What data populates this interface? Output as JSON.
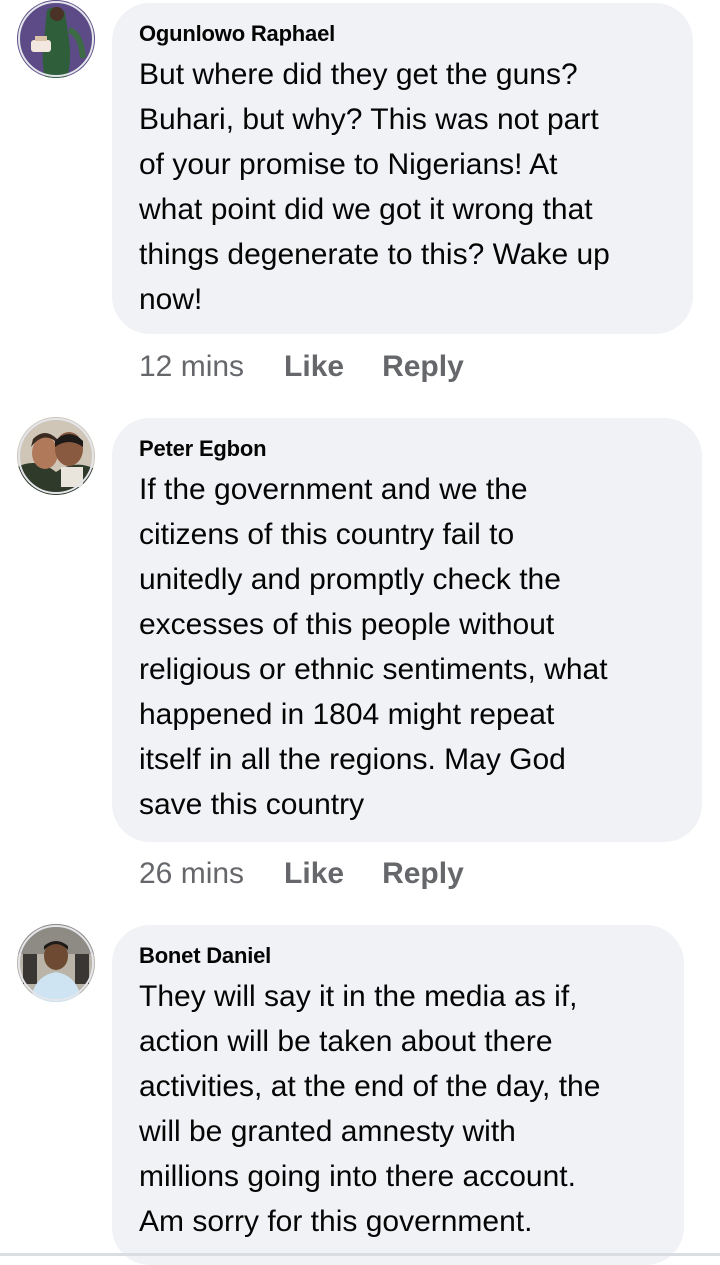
{
  "comments": [
    {
      "author": "Ogunlowo Raphael",
      "lines": [
        "But where did they get the guns?",
        "Buhari, but why?  This was not part",
        "of your promise to Nigerians!  At",
        "what point did we got it wrong that",
        "things degenerate to this? Wake up",
        "now!"
      ],
      "time": "12 mins",
      "like": "Like",
      "reply": "Reply"
    },
    {
      "author": "Peter Egbon",
      "lines": [
        "If the government and we the",
        "citizens of this country fail to",
        "unitedly and promptly check the",
        "excesses of this people without",
        "religious or ethnic sentiments, what",
        "happened in 1804 might repeat",
        "itself in all the regions. May God",
        "save this country"
      ],
      "time": "26 mins",
      "like": "Like",
      "reply": "Reply"
    },
    {
      "author": "Bonet Daniel",
      "lines": [
        "They will say it in the media as if,",
        "action will be taken about there",
        "activities, at the end of the day, the",
        "will be granted amnesty with",
        "millions going into there account.",
        "Am sorry for this government."
      ]
    }
  ],
  "colors": {
    "bubble": "#f0f2f5",
    "text": "#050505",
    "meta": "#65676b"
  }
}
